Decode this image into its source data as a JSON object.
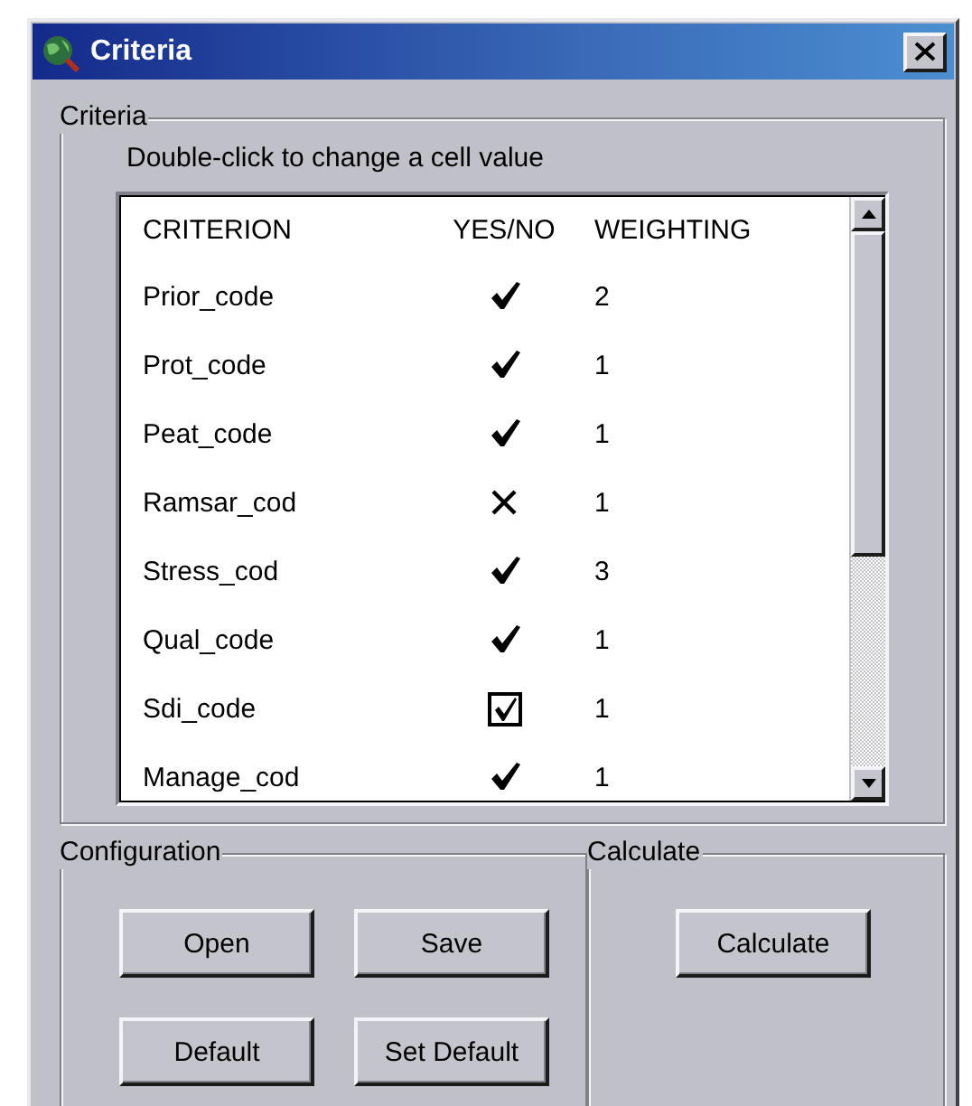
{
  "window": {
    "title": "Criteria"
  },
  "criteria_group": {
    "label": "Criteria",
    "hint": "Double-click to change a cell value",
    "table": {
      "columns": [
        "CRITERION",
        "YES/NO",
        "WEIGHTING"
      ],
      "rows": [
        {
          "criterion": "Prior_code",
          "yes": true,
          "editing": false,
          "weighting": "2"
        },
        {
          "criterion": "Prot_code",
          "yes": true,
          "editing": false,
          "weighting": "1"
        },
        {
          "criterion": "Peat_code",
          "yes": true,
          "editing": false,
          "weighting": "1"
        },
        {
          "criterion": "Ramsar_cod",
          "yes": false,
          "editing": false,
          "weighting": "1"
        },
        {
          "criterion": "Stress_cod",
          "yes": true,
          "editing": false,
          "weighting": "3"
        },
        {
          "criterion": "Qual_code",
          "yes": true,
          "editing": false,
          "weighting": "1"
        },
        {
          "criterion": "Sdi_code",
          "yes": true,
          "editing": true,
          "weighting": "1"
        },
        {
          "criterion": "Manage_cod",
          "yes": true,
          "editing": false,
          "weighting": "1"
        }
      ]
    }
  },
  "configuration_group": {
    "label": "Configuration",
    "buttons": [
      "Open",
      "Save",
      "Default",
      "Set Default"
    ]
  },
  "calculate_group": {
    "label": "Calculate",
    "buttons": [
      "Calculate"
    ]
  }
}
